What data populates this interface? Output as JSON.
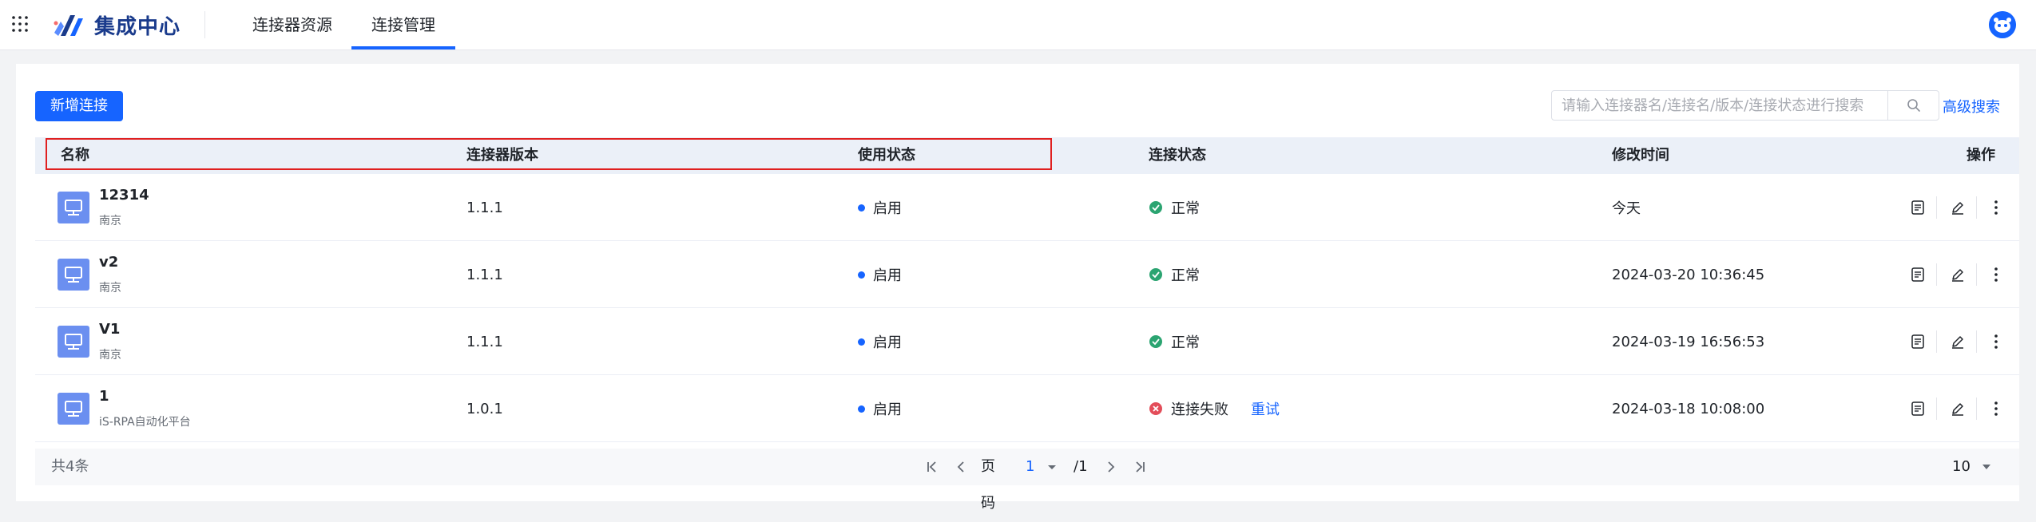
{
  "app": {
    "logo_text": "集成中心"
  },
  "nav": {
    "tabs": [
      "连接器资源",
      "连接管理"
    ],
    "active_index": 1
  },
  "toolbar": {
    "add_label": "新增连接",
    "search_placeholder": "请输入连接器名/连接名/版本/连接状态进行搜索",
    "advanced_search_label": "高级搜索"
  },
  "table": {
    "columns": [
      "名称",
      "连接器版本",
      "使用状态",
      "连接状态",
      "修改时间",
      "操作"
    ],
    "rows": [
      {
        "name": "12314",
        "sub": "南京",
        "version": "1.1.1",
        "usage": "启用",
        "conn_status": "正常",
        "conn_ok": true,
        "modified": "今天"
      },
      {
        "name": "v2",
        "sub": "南京",
        "version": "1.1.1",
        "usage": "启用",
        "conn_status": "正常",
        "conn_ok": true,
        "modified": "2024-03-20 10:36:45"
      },
      {
        "name": "V1",
        "sub": "南京",
        "version": "1.1.1",
        "usage": "启用",
        "conn_status": "正常",
        "conn_ok": true,
        "modified": "2024-03-19 16:56:53"
      },
      {
        "name": "1",
        "sub": "iS-RPA自动化平台",
        "version": "1.0.1",
        "usage": "启用",
        "conn_status": "连接失败",
        "conn_ok": false,
        "retry_label": "重试",
        "modified": "2024-03-18 10:08:00"
      }
    ]
  },
  "pagination": {
    "total_label": "共4条",
    "page_label": "页码",
    "current_page": "1",
    "total_pages": "/1",
    "page_size": "10"
  },
  "colors": {
    "accent": "#1664ff",
    "success": "#2ba471",
    "error": "#e34d59",
    "header_bg": "#ebf0f8"
  }
}
